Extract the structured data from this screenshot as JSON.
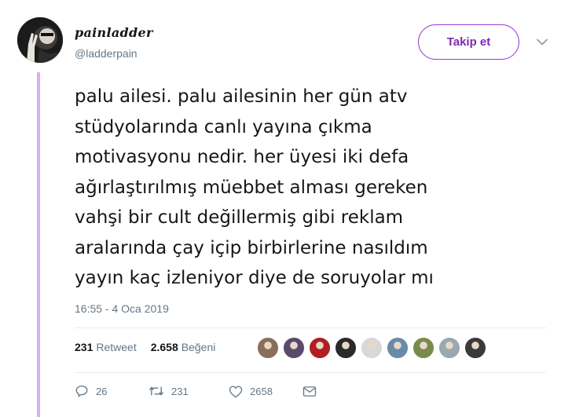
{
  "user": {
    "display_name": "painladder",
    "handle": "@ladderpain",
    "avatar_icon": "avatar-peace-sign"
  },
  "follow_button": {
    "label": "Takip et",
    "color": "#7d2ab3"
  },
  "menu_icon": "chevron-down-icon",
  "tweet": {
    "lines": [
      "palu ailesi. palu ailesinin her gün atv",
      "stüdyolarında canlı yayına çıkma",
      "motivasyonu nedir. her üyesi iki defa",
      "ağırlaştırılmış müebbet alması gereken",
      "vahşi bir cult değillermiş gibi reklam",
      "aralarında çay içip birbirlerine nasıldım",
      "yayın kaç izleniyor diye de soruyolar mı"
    ],
    "timestamp": "16:55 - 4 Oca 2019"
  },
  "stats": {
    "retweet_count": "231",
    "retweet_label": "Retweet",
    "like_count": "2.658",
    "like_label": "Beğeni"
  },
  "likers": [
    {
      "color": "#8a6f5a"
    },
    {
      "color": "#5a4a6a"
    },
    {
      "color": "#b02020"
    },
    {
      "color": "#2a2a2a"
    },
    {
      "color": "#d8d8d8"
    },
    {
      "color": "#6a8aa8"
    },
    {
      "color": "#7a8a4a"
    },
    {
      "color": "#9aa8b0"
    },
    {
      "color": "#3a3a3a"
    }
  ],
  "actions": {
    "reply_count": "26",
    "retweet_count": "231",
    "like_count": "2658"
  },
  "colors": {
    "accent": "#9b3bd1",
    "thread_line": "#d9aef5",
    "muted_text": "#657786"
  }
}
